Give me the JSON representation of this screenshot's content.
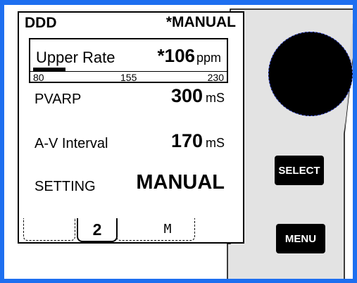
{
  "header": {
    "mode": "DDD",
    "status": "*MANUAL"
  },
  "upper_rate": {
    "label": "Upper Rate",
    "value": "*106",
    "unit": "ppm",
    "scale_min": "80",
    "scale_mid": "155",
    "scale_max": "230",
    "bar_fraction": 0.17
  },
  "rows": [
    {
      "label": "PVARP",
      "value": "300",
      "unit": "mS"
    },
    {
      "label": "A-V Interval",
      "value": "170",
      "unit": "mS"
    },
    {
      "label": "SETTING",
      "value": "MANUAL",
      "unit": ""
    }
  ],
  "tabs": {
    "active": "2",
    "other": "M"
  },
  "buttons": {
    "select": "SELECT",
    "menu": "MENU"
  }
}
